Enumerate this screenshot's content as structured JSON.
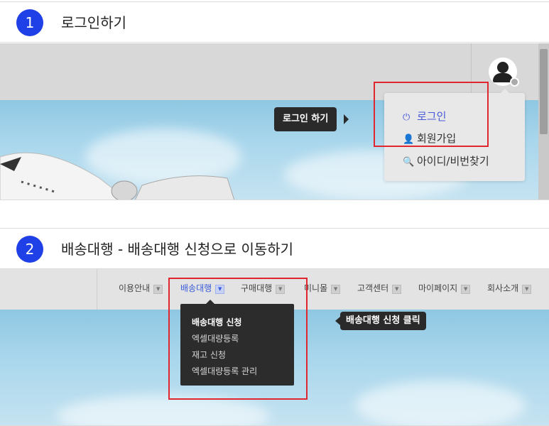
{
  "step1": {
    "number": "1",
    "title": "로그인하기",
    "tooltip": "로그인 하기",
    "menu": [
      {
        "label": "로그인",
        "icon": "power-icon",
        "color": "#4a5bd8"
      },
      {
        "label": "회원가입",
        "icon": "add-user-icon",
        "color": "#444444"
      },
      {
        "label": "아이디/비번찾기",
        "icon": "search-icon",
        "color": "#444444"
      }
    ]
  },
  "step2": {
    "number": "2",
    "title": "배송대행 - 배송대행 신청으로 이동하기",
    "tooltip": "배송대행 신청 클릭",
    "nav": [
      {
        "label": "이용안내"
      },
      {
        "label": "배송대행",
        "active": true
      },
      {
        "label": "구매대행"
      },
      {
        "label": "미니몰"
      },
      {
        "label": "고객센터"
      },
      {
        "label": "마이페이지"
      },
      {
        "label": "회사소개"
      }
    ],
    "dropdown": [
      "배송대행 신청",
      "엑셀대량등록",
      "재고 신청",
      "엑셀대량등록 관리"
    ]
  },
  "colors": {
    "accent": "#1e40e6",
    "highlight": "#e0262f",
    "active_nav": "#3b5bdb"
  }
}
